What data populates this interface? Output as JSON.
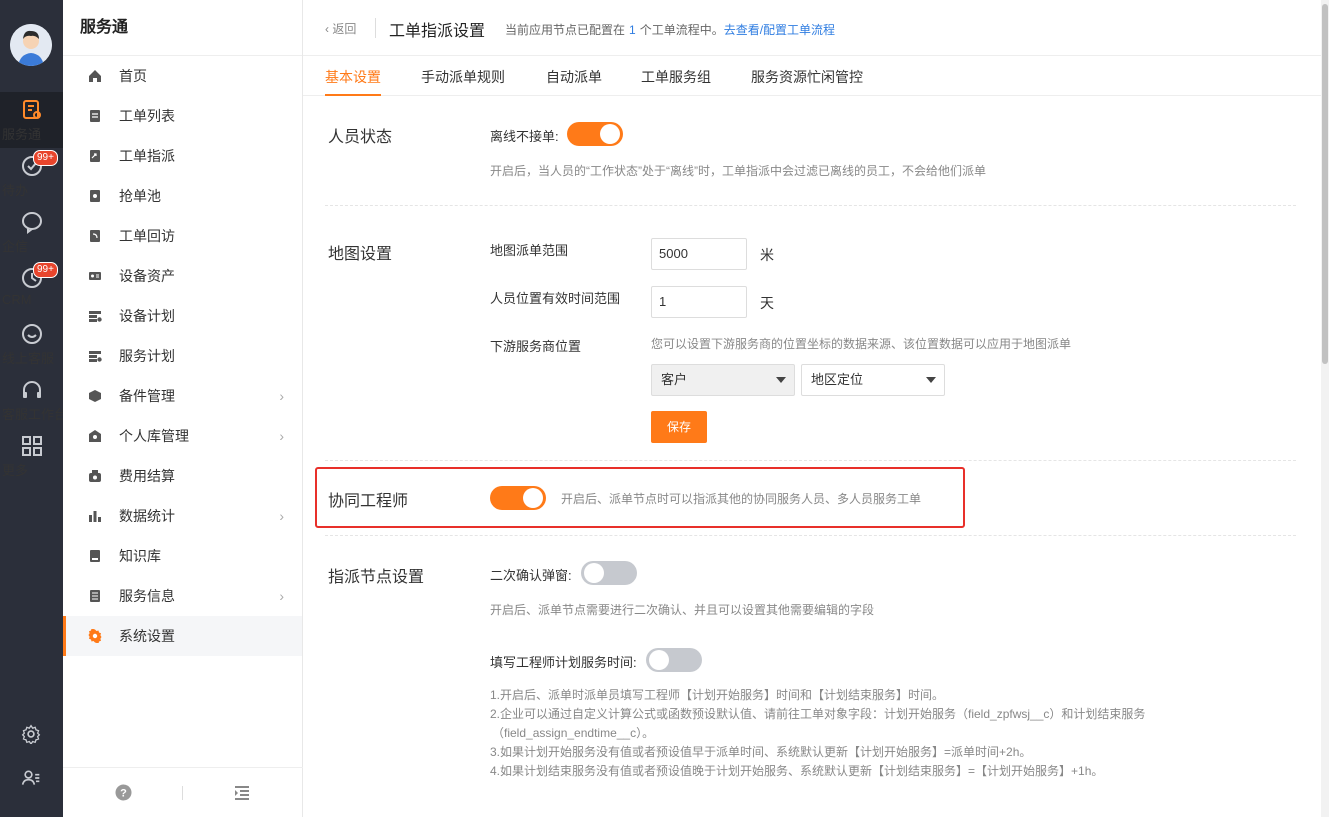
{
  "rail": {
    "items": [
      {
        "label": "服务通",
        "icon": "service-icon",
        "active": true
      },
      {
        "label": "待办",
        "icon": "todo-check-icon",
        "badge": "99+"
      },
      {
        "label": "企信",
        "icon": "chat-bubble-icon"
      },
      {
        "label": "CRM",
        "icon": "crm-icon",
        "badge": "99+"
      },
      {
        "label": "线上客服",
        "icon": "online-service-icon"
      },
      {
        "label": "客服工作台",
        "icon": "headset-icon"
      },
      {
        "label": "更多",
        "icon": "grid-more-icon"
      }
    ]
  },
  "sidebar": {
    "title": "服务通",
    "items": [
      {
        "label": "首页",
        "icon": "home-icon"
      },
      {
        "label": "工单列表",
        "icon": "list-icon"
      },
      {
        "label": "工单指派",
        "icon": "assign-icon"
      },
      {
        "label": "抢单池",
        "icon": "grab-order-icon"
      },
      {
        "label": "工单回访",
        "icon": "revisit-icon"
      },
      {
        "label": "设备资产",
        "icon": "asset-icon"
      },
      {
        "label": "设备计划",
        "icon": "device-plan-icon"
      },
      {
        "label": "服务计划",
        "icon": "service-plan-icon"
      },
      {
        "label": "备件管理",
        "icon": "parts-icon",
        "has_children": true
      },
      {
        "label": "个人库管理",
        "icon": "personal-store-icon",
        "has_children": true
      },
      {
        "label": "费用结算",
        "icon": "settlement-icon"
      },
      {
        "label": "数据统计",
        "icon": "bar-chart-icon",
        "has_children": true
      },
      {
        "label": "知识库",
        "icon": "knowledge-icon"
      },
      {
        "label": "服务信息",
        "icon": "service-info-icon",
        "has_children": true
      },
      {
        "label": "系统设置",
        "icon": "settings-gear-icon",
        "active": true
      }
    ]
  },
  "header": {
    "back_label": "返回",
    "title": "工单指派设置",
    "info_prefix": "当前应用节点已配置在",
    "info_count": "1",
    "info_suffix": "个工单流程中。",
    "info_link": "去查看/配置工单流程"
  },
  "tabs": [
    "基本设置",
    "手动派单规则",
    "自动派单",
    "工单服务组",
    "服务资源忙闲管控"
  ],
  "personnel": {
    "title": "人员状态",
    "offline_label": "离线不接单:",
    "offline_on": true,
    "hint": "开启后，当人员的“工作状态”处于“离线”时，工单指派中会过滤已离线的员工，不会给他们派单"
  },
  "map": {
    "title": "地图设置",
    "range_label": "地图派单范围",
    "range_value": "5000",
    "range_unit": "米",
    "valid_label": "人员位置有效时间范围",
    "valid_value": "1",
    "valid_unit": "天",
    "downstream_label": "下游服务商位置",
    "downstream_hint": "您可以设置下游服务商的位置坐标的数据来源、该位置数据可以应用于地图派单",
    "select1": "客户",
    "select2": "地区定位",
    "save": "保存"
  },
  "engineer": {
    "title": "协同工程师",
    "on": true,
    "hint": "开启后、派单节点时可以指派其他的协同服务人员、多人员服务工单"
  },
  "assign_node": {
    "title": "指派节点设置",
    "confirm_label": "二次确认弹窗:",
    "confirm_on": false,
    "confirm_hint": "开启后、派单节点需要进行二次确认、并且可以设置其他需要编辑的字段",
    "plan_label": "填写工程师计划服务时间:",
    "plan_on": false,
    "notes": [
      "1.开启后、派单时派单员填写工程师【计划开始服务】时间和【计划结束服务】时间。",
      "2.企业可以通过自定义计算公式或函数预设默认值、请前往工单对象字段：计划开始服务（field_zpfwsj__c）和计划结束服务",
      "（field_assign_endtime__c）。",
      "3.如果计划开始服务没有值或者预设值早于派单时间、系统默认更新【计划开始服务】=派单时间+2h。",
      "4.如果计划结束服务没有值或者预设值晚于计划开始服务、系统默认更新【计划结束服务】=【计划开始服务】+1h。"
    ]
  },
  "colors": {
    "accent": "#ff7a18",
    "rail_bg": "#2b2f3a",
    "link": "#2f7de1",
    "highlight_box": "#e8302a"
  }
}
